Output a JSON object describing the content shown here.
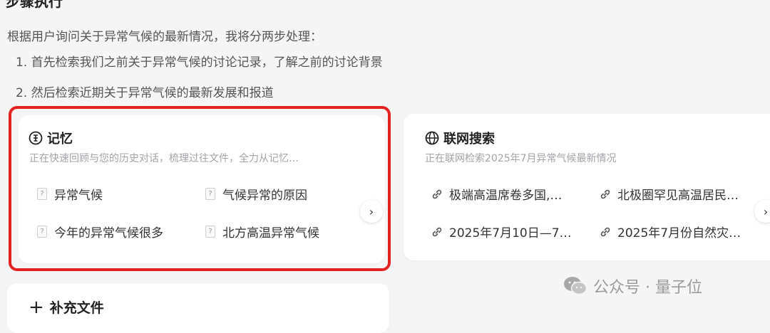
{
  "heading": "步骤执行",
  "intro": "根据用户询问关于异常气候的最新情况，我将分两步处理：",
  "steps": [
    "1. 首先检索我们之前关于异常气候的讨论记录，了解之前的讨论背景",
    "2. 然后检索近期关于异常气候的最新发展和报道"
  ],
  "memory_card": {
    "title": "记忆",
    "subtitle": "正在快速回顾与您的历史对话，梳理过往文件，全力从记忆…",
    "items": [
      "异常气候",
      "气候异常的原因",
      "今年的异常气候很多",
      "北方高温异常气候"
    ],
    "doc_glyph": "?",
    "next_glyph": "›"
  },
  "web_card": {
    "title": "联网搜索",
    "subtitle": "正在联网检索2025年7月异常气候最新情况",
    "links": [
      "极端高温席卷多国,…",
      "北极圈罕见高温居民…",
      "2025年7月10日—7…",
      "2025年7月份自然灾…"
    ],
    "next_glyph": "›"
  },
  "add_card": {
    "plus": "+",
    "label": "补充文件"
  },
  "watermark": "公众号 · 量子位",
  "colors": {
    "highlight": "#e52222",
    "background": "#f5f5f6",
    "card": "#ffffff"
  }
}
